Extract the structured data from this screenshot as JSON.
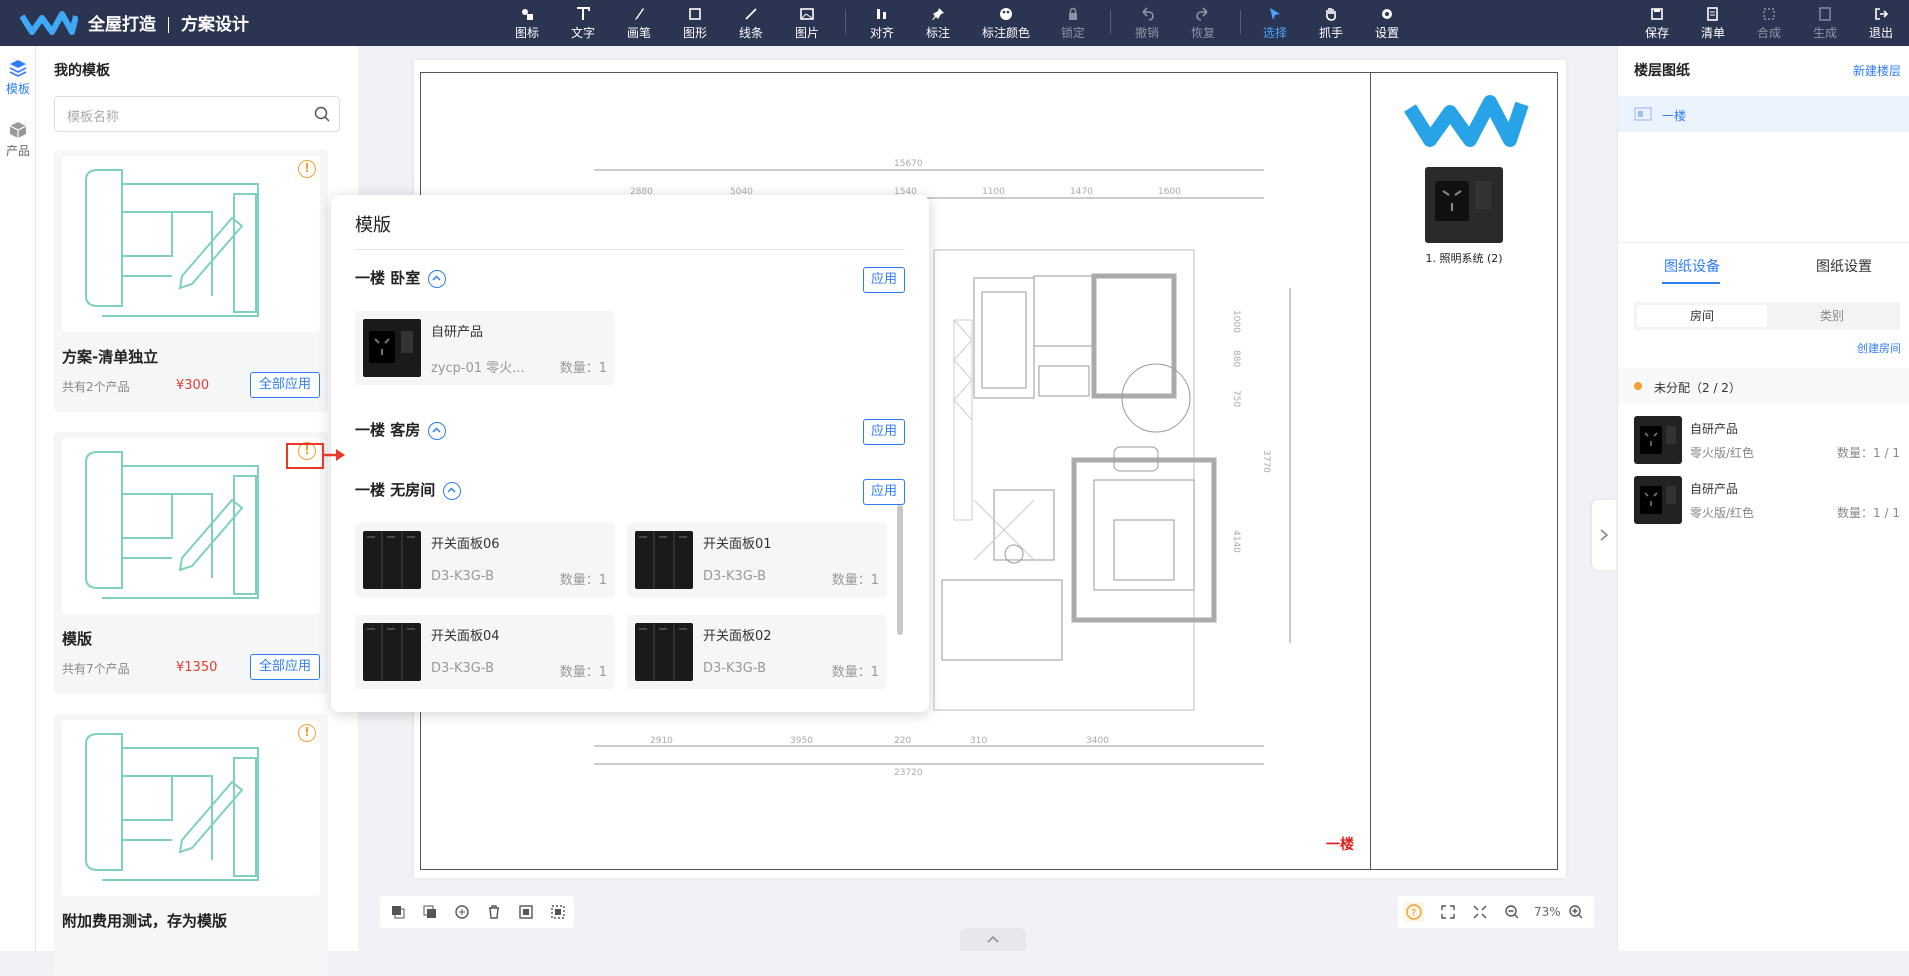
{
  "header": {
    "brand_a": "全屋打造",
    "brand_b": "方案设计",
    "tools": [
      {
        "label": "图标",
        "icon": "icon-tool-icon"
      },
      {
        "label": "文字",
        "icon": "text-tool-icon"
      },
      {
        "label": "画笔",
        "icon": "brush-icon"
      },
      {
        "label": "图形",
        "icon": "shape-icon"
      },
      {
        "label": "线条",
        "icon": "line-icon"
      },
      {
        "label": "图片",
        "icon": "image-icon"
      },
      {
        "label": "对齐",
        "icon": "align-icon"
      },
      {
        "label": "标注",
        "icon": "pin-icon"
      },
      {
        "label": "标注颜色",
        "icon": "palette-icon"
      },
      {
        "label": "锁定",
        "icon": "lock-icon"
      },
      {
        "label": "撤销",
        "icon": "undo-icon"
      },
      {
        "label": "恢复",
        "icon": "redo-icon"
      },
      {
        "label": "选择",
        "icon": "cursor-icon"
      },
      {
        "label": "抓手",
        "icon": "hand-icon"
      },
      {
        "label": "设置",
        "icon": "gear-icon"
      }
    ],
    "actions": [
      {
        "label": "保存",
        "icon": "save-icon"
      },
      {
        "label": "清单",
        "icon": "list-icon"
      },
      {
        "label": "合成",
        "icon": "merge-icon"
      },
      {
        "label": "生成",
        "icon": "generate-icon"
      },
      {
        "label": "退出",
        "icon": "exit-icon"
      }
    ]
  },
  "rail": {
    "items": [
      {
        "label": "模板",
        "icon": "layers-icon"
      },
      {
        "label": "产品",
        "icon": "box-icon"
      }
    ]
  },
  "left_panel": {
    "title": "我的模板",
    "search_placeholder": "模板名称",
    "cards": [
      {
        "name": "方案-清单独立",
        "count": "共有2个产品",
        "price": "¥300",
        "button": "全部应用"
      },
      {
        "name": "模版",
        "count": "共有7个产品",
        "price": "¥1350",
        "button": "全部应用"
      },
      {
        "name": "附加费用测试，存为模版",
        "count": "",
        "price": "",
        "button": ""
      }
    ]
  },
  "popup": {
    "title": "模版",
    "apply_label": "应用",
    "sections": [
      {
        "title": "一楼 卧室",
        "items": [
          {
            "name": "自研产品",
            "spec": "zycp-01 零火...",
            "qty": "数量：1"
          }
        ]
      },
      {
        "title": "一楼 客房",
        "items": []
      },
      {
        "title": "一楼 无房间",
        "items": [
          {
            "name": "开关面板06",
            "spec": "D3-K3G-B",
            "qty": "数量：1"
          },
          {
            "name": "开关面板01",
            "spec": "D3-K3G-B",
            "qty": "数量：1"
          },
          {
            "name": "开关面板04",
            "spec": "D3-K3G-B",
            "qty": "数量：1"
          },
          {
            "name": "开关面板02",
            "spec": "D3-K3G-B",
            "qty": "数量：1"
          }
        ]
      }
    ]
  },
  "canvas": {
    "caption": "1. 照明系统 (2)",
    "floor_label": "一楼",
    "zoom": "73%",
    "dims_top": [
      "15670",
      "2880",
      "5040",
      "1540",
      "1100",
      "1470",
      "1600"
    ],
    "dims_bottom": [
      "2910",
      "3950",
      "220",
      "310",
      "3400",
      "23720"
    ],
    "dims_right": [
      "1000",
      "880",
      "750",
      "3770",
      "4140"
    ]
  },
  "right_panel": {
    "title": "楼层图纸",
    "new_floor": "新建楼层",
    "floor": "一楼",
    "tabs": [
      "图纸设备",
      "图纸设置"
    ],
    "seg": [
      "房间",
      "类别"
    ],
    "create_room": "创建房间",
    "group": "未分配（2 / 2）",
    "items": [
      {
        "name": "自研产品",
        "spec": "零火版/红色",
        "qty": "数量：1 / 1"
      },
      {
        "name": "自研产品",
        "spec": "零火版/红色",
        "qty": "数量：1 / 1"
      }
    ]
  },
  "colors": {
    "accent": "#2f7df6",
    "header": "#2b3552",
    "price": "#e63c2e",
    "warn": "#f0a030",
    "plan_teal": "#7fd0c0"
  }
}
